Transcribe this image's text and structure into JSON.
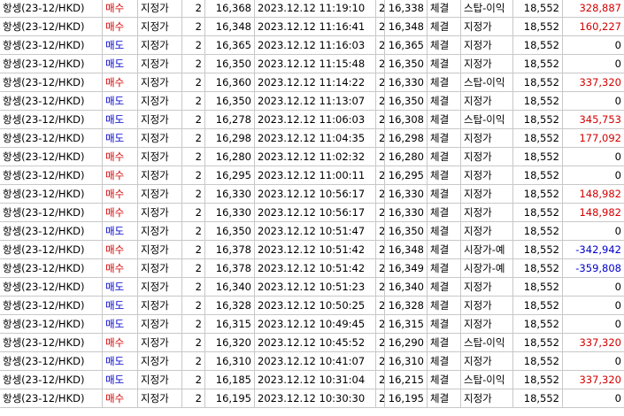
{
  "colors": {
    "buy": "#d40000",
    "sell": "#0000cc",
    "grid": "#c8c8c8"
  },
  "rows": [
    {
      "name": "항셍(23-12/HKD)",
      "side": "매수",
      "side_type": "buy",
      "order_type": "지정가",
      "qty": "2",
      "order_price": "16,368",
      "time": "2023.12.12 11:19:10",
      "fill_qty": "2",
      "fill_price": "16,338",
      "status": "체결",
      "exec_type": "스탑-이익",
      "margin": "18,552",
      "pnl": "328,887",
      "pnl_sign": "pos"
    },
    {
      "name": "항셍(23-12/HKD)",
      "side": "매수",
      "side_type": "buy",
      "order_type": "지정가",
      "qty": "2",
      "order_price": "16,348",
      "time": "2023.12.12 11:16:41",
      "fill_qty": "2",
      "fill_price": "16,348",
      "status": "체결",
      "exec_type": "지정가",
      "margin": "18,552",
      "pnl": "160,227",
      "pnl_sign": "pos"
    },
    {
      "name": "항셍(23-12/HKD)",
      "side": "매도",
      "side_type": "sell",
      "order_type": "지정가",
      "qty": "2",
      "order_price": "16,365",
      "time": "2023.12.12 11:16:03",
      "fill_qty": "2",
      "fill_price": "16,365",
      "status": "체결",
      "exec_type": "지정가",
      "margin": "18,552",
      "pnl": "0",
      "pnl_sign": "zero"
    },
    {
      "name": "항셍(23-12/HKD)",
      "side": "매도",
      "side_type": "sell",
      "order_type": "지정가",
      "qty": "2",
      "order_price": "16,350",
      "time": "2023.12.12 11:15:48",
      "fill_qty": "2",
      "fill_price": "16,350",
      "status": "체결",
      "exec_type": "지정가",
      "margin": "18,552",
      "pnl": "0",
      "pnl_sign": "zero"
    },
    {
      "name": "항셍(23-12/HKD)",
      "side": "매수",
      "side_type": "buy",
      "order_type": "지정가",
      "qty": "2",
      "order_price": "16,360",
      "time": "2023.12.12 11:14:22",
      "fill_qty": "2",
      "fill_price": "16,330",
      "status": "체결",
      "exec_type": "스탑-이익",
      "margin": "18,552",
      "pnl": "337,320",
      "pnl_sign": "pos"
    },
    {
      "name": "항셍(23-12/HKD)",
      "side": "매도",
      "side_type": "sell",
      "order_type": "지정가",
      "qty": "2",
      "order_price": "16,350",
      "time": "2023.12.12 11:13:07",
      "fill_qty": "2",
      "fill_price": "16,350",
      "status": "체결",
      "exec_type": "지정가",
      "margin": "18,552",
      "pnl": "0",
      "pnl_sign": "zero"
    },
    {
      "name": "항셍(23-12/HKD)",
      "side": "매도",
      "side_type": "sell",
      "order_type": "지정가",
      "qty": "2",
      "order_price": "16,278",
      "time": "2023.12.12 11:06:03",
      "fill_qty": "2",
      "fill_price": "16,308",
      "status": "체결",
      "exec_type": "스탑-이익",
      "margin": "18,552",
      "pnl": "345,753",
      "pnl_sign": "pos"
    },
    {
      "name": "항셍(23-12/HKD)",
      "side": "매도",
      "side_type": "sell",
      "order_type": "지정가",
      "qty": "2",
      "order_price": "16,298",
      "time": "2023.12.12 11:04:35",
      "fill_qty": "2",
      "fill_price": "16,298",
      "status": "체결",
      "exec_type": "지정가",
      "margin": "18,552",
      "pnl": "177,092",
      "pnl_sign": "pos"
    },
    {
      "name": "항셍(23-12/HKD)",
      "side": "매수",
      "side_type": "buy",
      "order_type": "지정가",
      "qty": "2",
      "order_price": "16,280",
      "time": "2023.12.12 11:02:32",
      "fill_qty": "2",
      "fill_price": "16,280",
      "status": "체결",
      "exec_type": "지정가",
      "margin": "18,552",
      "pnl": "0",
      "pnl_sign": "zero"
    },
    {
      "name": "항셍(23-12/HKD)",
      "side": "매수",
      "side_type": "buy",
      "order_type": "지정가",
      "qty": "2",
      "order_price": "16,295",
      "time": "2023.12.12 11:00:11",
      "fill_qty": "2",
      "fill_price": "16,295",
      "status": "체결",
      "exec_type": "지정가",
      "margin": "18,552",
      "pnl": "0",
      "pnl_sign": "zero"
    },
    {
      "name": "항셍(23-12/HKD)",
      "side": "매수",
      "side_type": "buy",
      "order_type": "지정가",
      "qty": "2",
      "order_price": "16,330",
      "time": "2023.12.12 10:56:17",
      "fill_qty": "2",
      "fill_price": "16,330",
      "status": "체결",
      "exec_type": "지정가",
      "margin": "18,552",
      "pnl": "148,982",
      "pnl_sign": "pos"
    },
    {
      "name": "항셍(23-12/HKD)",
      "side": "매수",
      "side_type": "buy",
      "order_type": "지정가",
      "qty": "2",
      "order_price": "16,330",
      "time": "2023.12.12 10:56:17",
      "fill_qty": "2",
      "fill_price": "16,330",
      "status": "체결",
      "exec_type": "지정가",
      "margin": "18,552",
      "pnl": "148,982",
      "pnl_sign": "pos"
    },
    {
      "name": "항셍(23-12/HKD)",
      "side": "매도",
      "side_type": "sell",
      "order_type": "지정가",
      "qty": "2",
      "order_price": "16,350",
      "time": "2023.12.12 10:51:47",
      "fill_qty": "2",
      "fill_price": "16,350",
      "status": "체결",
      "exec_type": "지정가",
      "margin": "18,552",
      "pnl": "0",
      "pnl_sign": "zero"
    },
    {
      "name": "항셍(23-12/HKD)",
      "side": "매수",
      "side_type": "buy",
      "order_type": "지정가",
      "qty": "2",
      "order_price": "16,378",
      "time": "2023.12.12 10:51:42",
      "fill_qty": "2",
      "fill_price": "16,348",
      "status": "체결",
      "exec_type": "시장가-예",
      "margin": "18,552",
      "pnl": "-342,942",
      "pnl_sign": "neg"
    },
    {
      "name": "항셍(23-12/HKD)",
      "side": "매수",
      "side_type": "buy",
      "order_type": "지정가",
      "qty": "2",
      "order_price": "16,378",
      "time": "2023.12.12 10:51:42",
      "fill_qty": "2",
      "fill_price": "16,349",
      "status": "체결",
      "exec_type": "시장가-예",
      "margin": "18,552",
      "pnl": "-359,808",
      "pnl_sign": "neg"
    },
    {
      "name": "항셍(23-12/HKD)",
      "side": "매도",
      "side_type": "sell",
      "order_type": "지정가",
      "qty": "2",
      "order_price": "16,340",
      "time": "2023.12.12 10:51:23",
      "fill_qty": "2",
      "fill_price": "16,340",
      "status": "체결",
      "exec_type": "지정가",
      "margin": "18,552",
      "pnl": "0",
      "pnl_sign": "zero"
    },
    {
      "name": "항셍(23-12/HKD)",
      "side": "매도",
      "side_type": "sell",
      "order_type": "지정가",
      "qty": "2",
      "order_price": "16,328",
      "time": "2023.12.12 10:50:25",
      "fill_qty": "2",
      "fill_price": "16,328",
      "status": "체결",
      "exec_type": "지정가",
      "margin": "18,552",
      "pnl": "0",
      "pnl_sign": "zero"
    },
    {
      "name": "항셍(23-12/HKD)",
      "side": "매도",
      "side_type": "sell",
      "order_type": "지정가",
      "qty": "2",
      "order_price": "16,315",
      "time": "2023.12.12 10:49:45",
      "fill_qty": "2",
      "fill_price": "16,315",
      "status": "체결",
      "exec_type": "지정가",
      "margin": "18,552",
      "pnl": "0",
      "pnl_sign": "zero"
    },
    {
      "name": "항셍(23-12/HKD)",
      "side": "매수",
      "side_type": "buy",
      "order_type": "지정가",
      "qty": "2",
      "order_price": "16,320",
      "time": "2023.12.12 10:45:52",
      "fill_qty": "2",
      "fill_price": "16,290",
      "status": "체결",
      "exec_type": "스탑-이익",
      "margin": "18,552",
      "pnl": "337,320",
      "pnl_sign": "pos"
    },
    {
      "name": "항셍(23-12/HKD)",
      "side": "매도",
      "side_type": "sell",
      "order_type": "지정가",
      "qty": "2",
      "order_price": "16,310",
      "time": "2023.12.12 10:41:07",
      "fill_qty": "2",
      "fill_price": "16,310",
      "status": "체결",
      "exec_type": "지정가",
      "margin": "18,552",
      "pnl": "0",
      "pnl_sign": "zero"
    },
    {
      "name": "항셍(23-12/HKD)",
      "side": "매도",
      "side_type": "sell",
      "order_type": "지정가",
      "qty": "2",
      "order_price": "16,185",
      "time": "2023.12.12 10:31:04",
      "fill_qty": "2",
      "fill_price": "16,215",
      "status": "체결",
      "exec_type": "스탑-이익",
      "margin": "18,552",
      "pnl": "337,320",
      "pnl_sign": "pos"
    },
    {
      "name": "항셍(23-12/HKD)",
      "side": "매수",
      "side_type": "buy",
      "order_type": "지정가",
      "qty": "2",
      "order_price": "16,195",
      "time": "2023.12.12 10:30:30",
      "fill_qty": "2",
      "fill_price": "16,195",
      "status": "체결",
      "exec_type": "지정가",
      "margin": "18,552",
      "pnl": "0",
      "pnl_sign": "zero"
    }
  ]
}
